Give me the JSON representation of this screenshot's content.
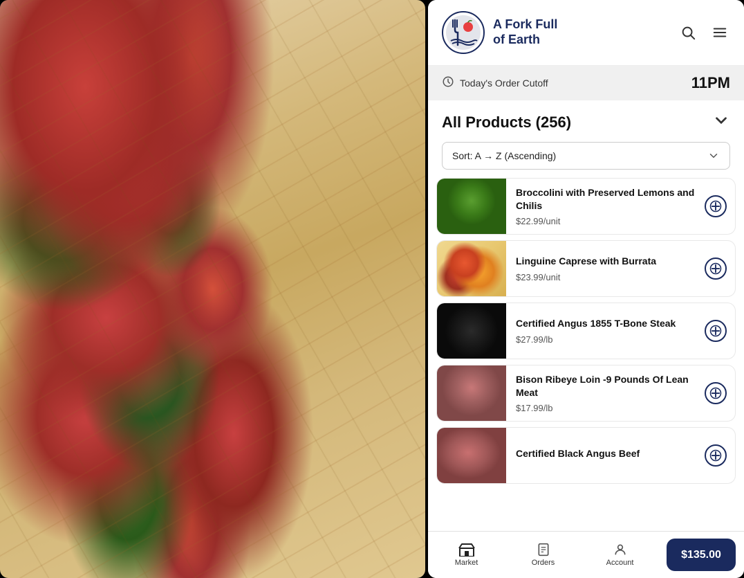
{
  "app": {
    "title": "A Fork Full of Earth"
  },
  "header": {
    "brand_line1": "A Fork Full",
    "brand_line2": "of Earth",
    "search_label": "search",
    "menu_label": "menu"
  },
  "cutoff_banner": {
    "label": "Today's Order Cutoff",
    "time": "11PM"
  },
  "products_section": {
    "title": "All Products (256)",
    "sort_label": "Sort: A → Z (Ascending)"
  },
  "products": [
    {
      "id": 1,
      "name": "Broccolini with Preserved Lemons and Chilis",
      "price": "$22.99/unit",
      "img_class": "product-img-broccolini"
    },
    {
      "id": 2,
      "name": "Linguine Caprese with Burrata",
      "price": "$23.99/unit",
      "img_class": "product-img-linguine"
    },
    {
      "id": 3,
      "name": "Certified Angus 1855 T-Bone Steak",
      "price": "$27.99/lb",
      "img_class": "product-img-tbone"
    },
    {
      "id": 4,
      "name": "Bison Ribeye Loin -9 Pounds Of Lean Meat",
      "price": "$17.99/lb",
      "img_class": "product-img-bison"
    },
    {
      "id": 5,
      "name": "Certified Black Angus Beef",
      "price": "",
      "img_class": "product-img-blackangus"
    }
  ],
  "bottom_nav": {
    "market_label": "Market",
    "orders_label": "Orders",
    "account_label": "Account",
    "cart_total": "$135.00"
  }
}
